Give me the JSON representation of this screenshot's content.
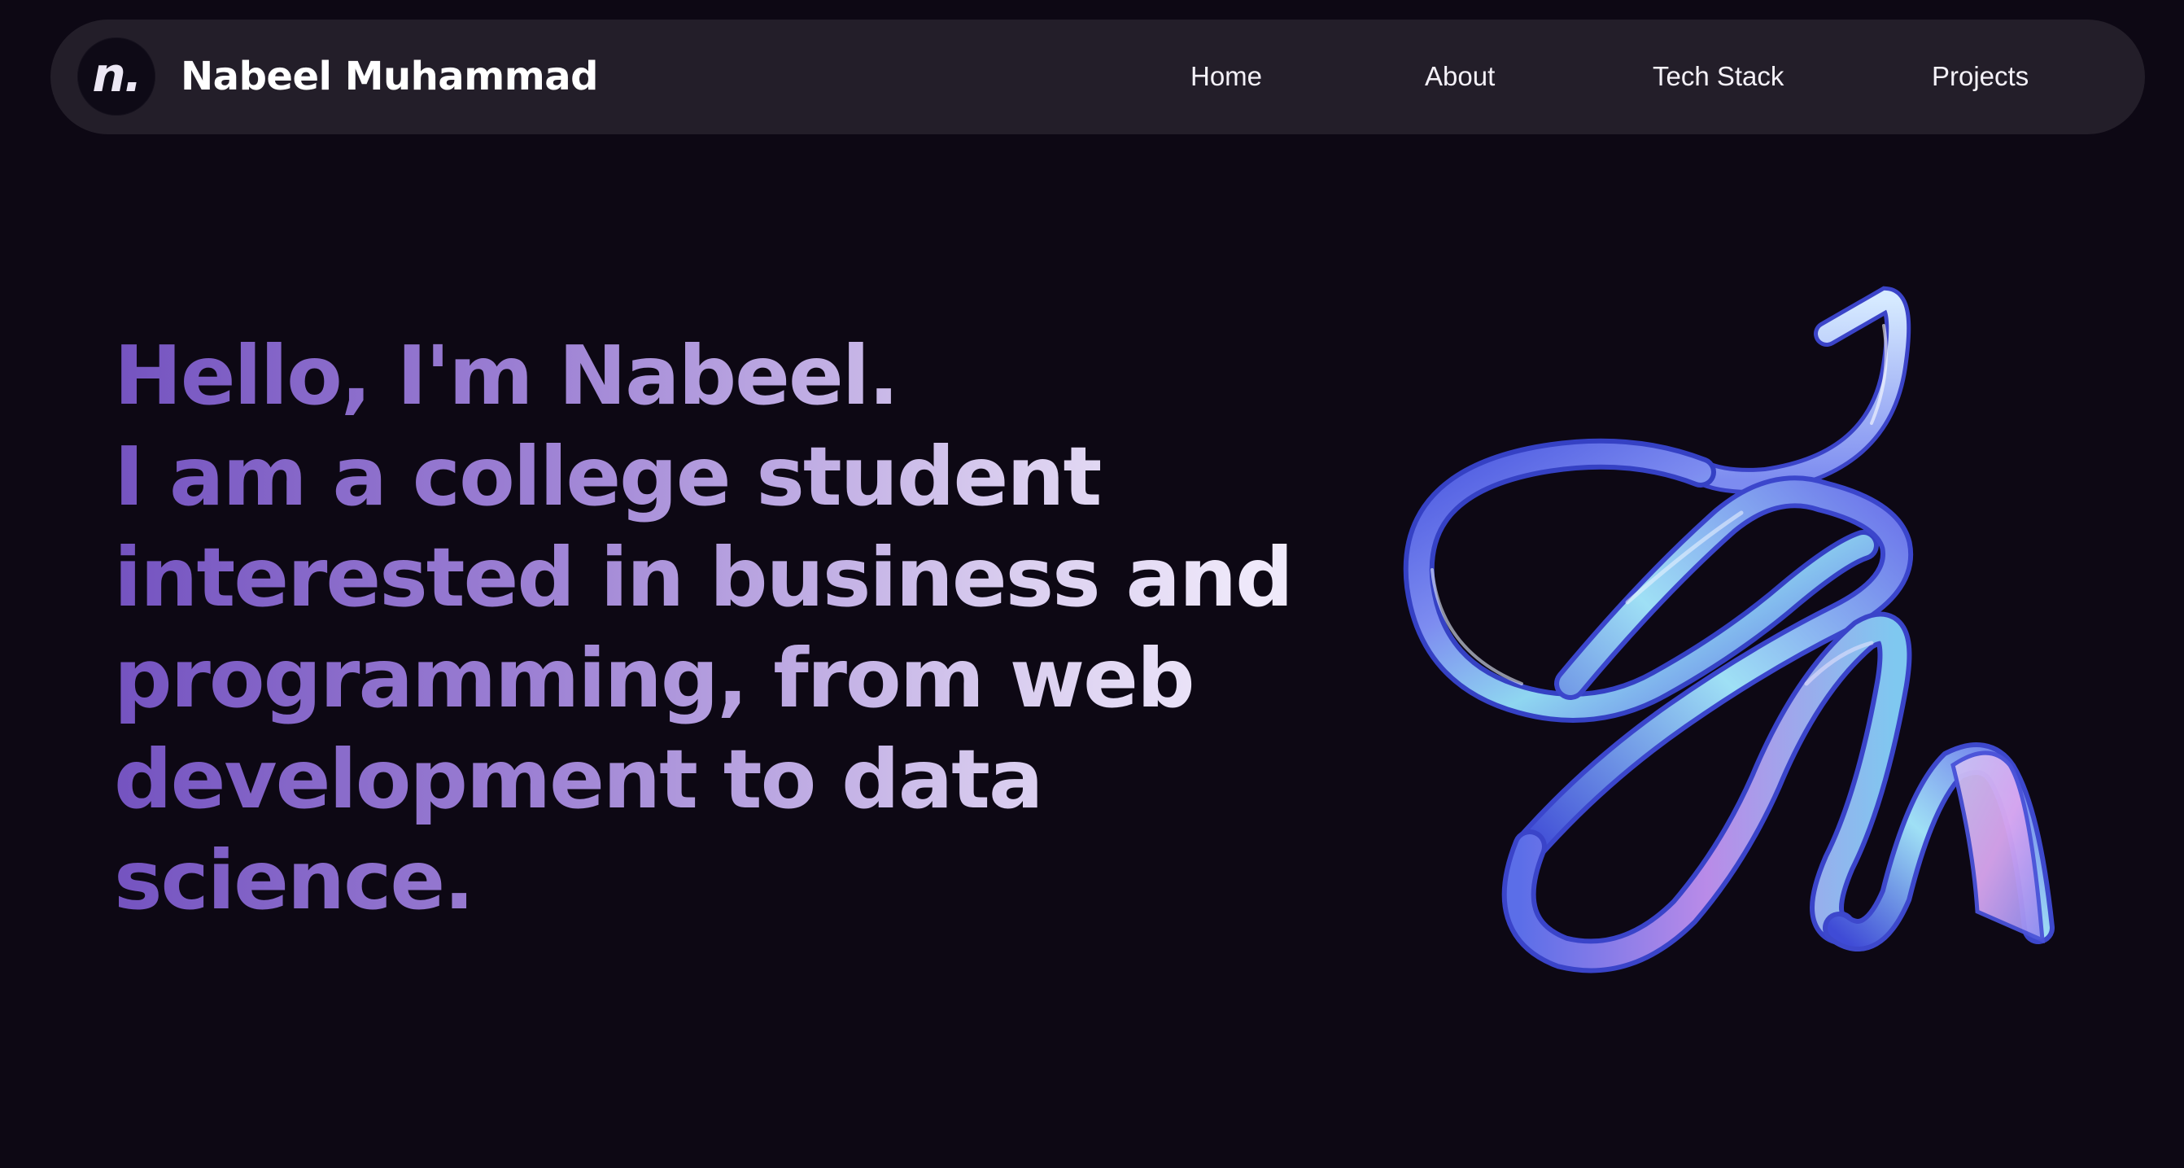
{
  "navbar": {
    "logo_glyph": "n.",
    "brand_name": "Nabeel Muhammad",
    "links": [
      {
        "label": "Home"
      },
      {
        "label": "About"
      },
      {
        "label": "Tech Stack"
      },
      {
        "label": "Projects"
      }
    ]
  },
  "hero": {
    "lines": [
      "Hello, I'm Nabeel.",
      "I am a college student",
      "interested in business and",
      "programming, from web",
      "development to data",
      "science."
    ]
  },
  "colors": {
    "background": "#0d0814",
    "navbar": "#231e29",
    "heading_gradient_start": "#7453c0",
    "heading_gradient_end": "#efe9fa",
    "ribbon_blue": "#5b6ee8",
    "ribbon_cyan": "#8fd6f0",
    "ribbon_violet": "#b98be8"
  },
  "icons": {
    "logo": "n-monogram-logo",
    "illustration": "3d-glass-ribbon"
  }
}
